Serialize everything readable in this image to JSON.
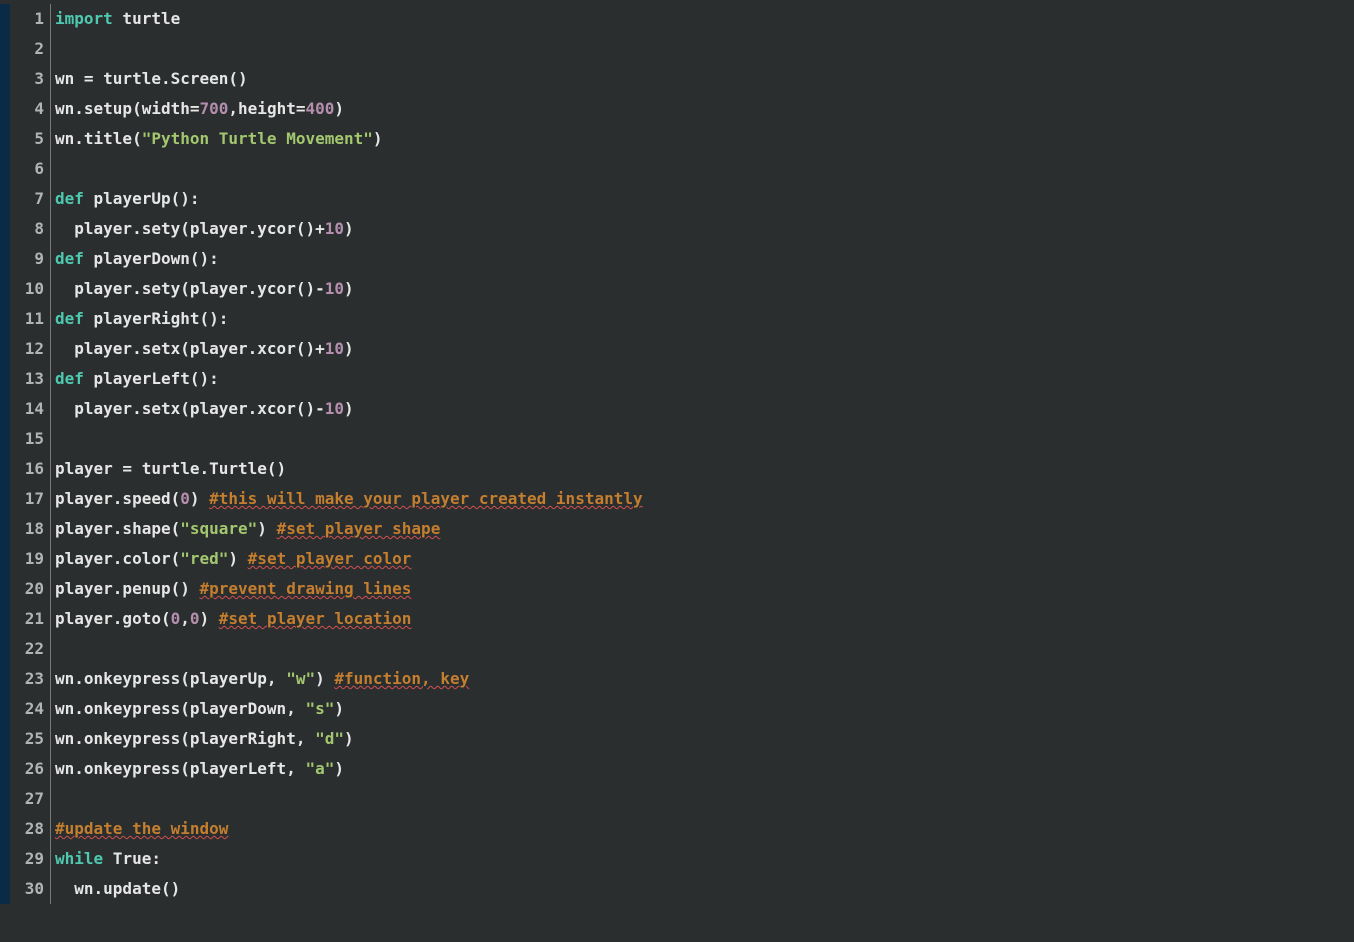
{
  "editor": {
    "language": "python",
    "line_count": 30,
    "lines": [
      {
        "n": 1,
        "tokens": [
          {
            "cls": "tok-kw",
            "t": "import"
          },
          {
            "cls": "tok-default",
            "t": " turtle"
          }
        ]
      },
      {
        "n": 2,
        "tokens": []
      },
      {
        "n": 3,
        "tokens": [
          {
            "cls": "tok-default",
            "t": "wn = turtle.Screen()"
          }
        ]
      },
      {
        "n": 4,
        "tokens": [
          {
            "cls": "tok-default",
            "t": "wn.setup(width="
          },
          {
            "cls": "tok-num",
            "t": "700"
          },
          {
            "cls": "tok-default",
            "t": ",height="
          },
          {
            "cls": "tok-num",
            "t": "400"
          },
          {
            "cls": "tok-default",
            "t": ")"
          }
        ]
      },
      {
        "n": 5,
        "tokens": [
          {
            "cls": "tok-default",
            "t": "wn.title("
          },
          {
            "cls": "tok-str",
            "t": "\"Python Turtle Movement\""
          },
          {
            "cls": "tok-default",
            "t": ")"
          }
        ]
      },
      {
        "n": 6,
        "tokens": []
      },
      {
        "n": 7,
        "tokens": [
          {
            "cls": "tok-kw",
            "t": "def"
          },
          {
            "cls": "tok-default",
            "t": " playerUp():"
          }
        ]
      },
      {
        "n": 8,
        "tokens": [
          {
            "cls": "tok-default",
            "t": "  player.sety(player.ycor()+"
          },
          {
            "cls": "tok-num",
            "t": "10"
          },
          {
            "cls": "tok-default",
            "t": ")"
          }
        ]
      },
      {
        "n": 9,
        "tokens": [
          {
            "cls": "tok-kw",
            "t": "def"
          },
          {
            "cls": "tok-default",
            "t": " playerDown():"
          }
        ]
      },
      {
        "n": 10,
        "tokens": [
          {
            "cls": "tok-default",
            "t": "  player.sety(player.ycor()-"
          },
          {
            "cls": "tok-num",
            "t": "10"
          },
          {
            "cls": "tok-default",
            "t": ")"
          }
        ]
      },
      {
        "n": 11,
        "tokens": [
          {
            "cls": "tok-kw",
            "t": "def"
          },
          {
            "cls": "tok-default",
            "t": " playerRight():"
          }
        ]
      },
      {
        "n": 12,
        "tokens": [
          {
            "cls": "tok-default",
            "t": "  player.setx(player.xcor()+"
          },
          {
            "cls": "tok-num",
            "t": "10"
          },
          {
            "cls": "tok-default",
            "t": ")"
          }
        ]
      },
      {
        "n": 13,
        "tokens": [
          {
            "cls": "tok-kw",
            "t": "def"
          },
          {
            "cls": "tok-default",
            "t": " playerLeft():"
          }
        ]
      },
      {
        "n": 14,
        "tokens": [
          {
            "cls": "tok-default",
            "t": "  player.setx(player.xcor()-"
          },
          {
            "cls": "tok-num",
            "t": "10"
          },
          {
            "cls": "tok-default",
            "t": ")"
          }
        ]
      },
      {
        "n": 15,
        "tokens": []
      },
      {
        "n": 16,
        "tokens": [
          {
            "cls": "tok-default",
            "t": "player = turtle.Turtle()"
          }
        ]
      },
      {
        "n": 17,
        "tokens": [
          {
            "cls": "tok-default",
            "t": "player.speed("
          },
          {
            "cls": "tok-num",
            "t": "0"
          },
          {
            "cls": "tok-default",
            "t": ") "
          },
          {
            "cls": "tok-comment squiggle",
            "t": "#this will make your player created instantly"
          }
        ]
      },
      {
        "n": 18,
        "tokens": [
          {
            "cls": "tok-default",
            "t": "player.shape("
          },
          {
            "cls": "tok-str",
            "t": "\"square\""
          },
          {
            "cls": "tok-default",
            "t": ") "
          },
          {
            "cls": "tok-comment squiggle",
            "t": "#set player shape"
          }
        ]
      },
      {
        "n": 19,
        "tokens": [
          {
            "cls": "tok-default",
            "t": "player.color("
          },
          {
            "cls": "tok-str",
            "t": "\"red\""
          },
          {
            "cls": "tok-default",
            "t": ") "
          },
          {
            "cls": "tok-comment squiggle",
            "t": "#set player color"
          }
        ]
      },
      {
        "n": 20,
        "tokens": [
          {
            "cls": "tok-default",
            "t": "player.penup() "
          },
          {
            "cls": "tok-comment squiggle",
            "t": "#prevent drawing lines"
          }
        ]
      },
      {
        "n": 21,
        "tokens": [
          {
            "cls": "tok-default",
            "t": "player.goto("
          },
          {
            "cls": "tok-num",
            "t": "0"
          },
          {
            "cls": "tok-default",
            "t": ","
          },
          {
            "cls": "tok-num",
            "t": "0"
          },
          {
            "cls": "tok-default",
            "t": ") "
          },
          {
            "cls": "tok-comment squiggle",
            "t": "#set player location"
          }
        ]
      },
      {
        "n": 22,
        "tokens": []
      },
      {
        "n": 23,
        "tokens": [
          {
            "cls": "tok-default",
            "t": "wn.onkeypress(playerUp, "
          },
          {
            "cls": "tok-str",
            "t": "\"w\""
          },
          {
            "cls": "tok-default",
            "t": ") "
          },
          {
            "cls": "tok-comment squiggle",
            "t": "#function, key"
          }
        ]
      },
      {
        "n": 24,
        "tokens": [
          {
            "cls": "tok-default",
            "t": "wn.onkeypress(playerDown, "
          },
          {
            "cls": "tok-str",
            "t": "\"s\""
          },
          {
            "cls": "tok-default",
            "t": ")"
          }
        ]
      },
      {
        "n": 25,
        "tokens": [
          {
            "cls": "tok-default",
            "t": "wn.onkeypress(playerRight, "
          },
          {
            "cls": "tok-str",
            "t": "\"d\""
          },
          {
            "cls": "tok-default",
            "t": ")"
          }
        ]
      },
      {
        "n": 26,
        "tokens": [
          {
            "cls": "tok-default",
            "t": "wn.onkeypress(playerLeft, "
          },
          {
            "cls": "tok-str",
            "t": "\"a\""
          },
          {
            "cls": "tok-default",
            "t": ")"
          }
        ]
      },
      {
        "n": 27,
        "tokens": []
      },
      {
        "n": 28,
        "tokens": [
          {
            "cls": "tok-comment squiggle",
            "t": "#update the window"
          }
        ]
      },
      {
        "n": 29,
        "tokens": [
          {
            "cls": "tok-kw",
            "t": "while"
          },
          {
            "cls": "tok-default",
            "t": " True:"
          }
        ]
      },
      {
        "n": 30,
        "tokens": [
          {
            "cls": "tok-default",
            "t": "  wn.update()"
          }
        ]
      }
    ]
  }
}
